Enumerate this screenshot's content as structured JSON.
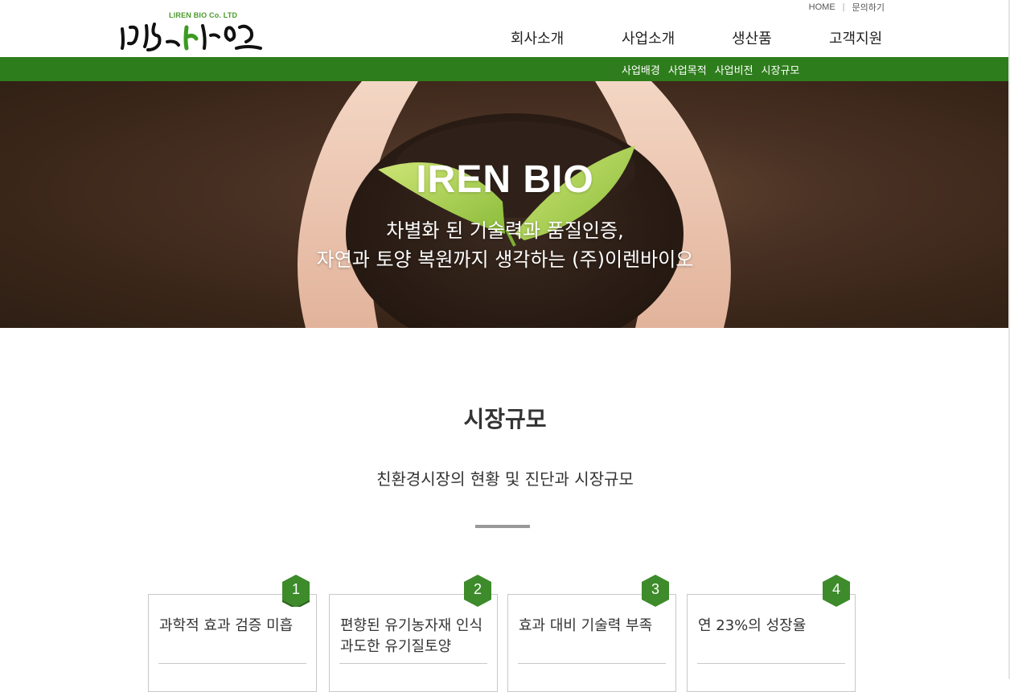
{
  "header": {
    "logo": {
      "sub": "LIREN BIO Co. LTD",
      "text": "이렌바이오"
    },
    "util": {
      "home": "HOME",
      "contact": "문의하기"
    },
    "gnb": [
      "회사소개",
      "사업소개",
      "생산품",
      "고객지원"
    ]
  },
  "subnav": [
    "사업배경",
    "사업목적",
    "사업비전",
    "시장규모"
  ],
  "hero": {
    "title": "IREN BIO",
    "line1": "차별화 된 기술력과 품질인증,",
    "line2": "자연과 토양 복원까지 생각하는 (주)이렌바이오"
  },
  "section": {
    "title": "시장규모",
    "subtitle": "친환경시장의 현황 및 진단과 시장규모"
  },
  "cards": [
    {
      "num": "1",
      "text": "과학적 효과 검증 미흡"
    },
    {
      "num": "2",
      "text": "편향된 유기농자재 인식 과도한 유기질토양"
    },
    {
      "num": "3",
      "text": "효과 대비 기술력 부족"
    },
    {
      "num": "4",
      "text": "연 23%의 성장율"
    }
  ],
  "colors": {
    "brand_green": "#2e7d1c",
    "badge_green": "#3d8b2a"
  }
}
